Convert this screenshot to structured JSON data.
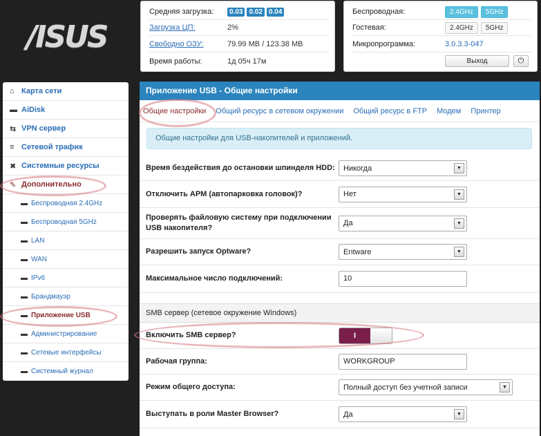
{
  "logo": "/ISUS",
  "status_left": {
    "load_label": "Средняя загрузка:",
    "load_values": [
      "0.03",
      "0.02",
      "0.04"
    ],
    "cpu_label": "Загрузка ЦП:",
    "cpu_value": "2%",
    "ram_label": "Свободно ОЗУ:",
    "ram_value": "79.99 MB / 123.38 MB",
    "uptime_label": "Время работы:",
    "uptime_value": "1д 05ч 17м"
  },
  "status_right": {
    "wireless_label": "Беспроводная:",
    "wireless_2g": "2.4GHz",
    "wireless_5g": "5GHz",
    "guest_label": "Гостевая:",
    "guest_2g": "2.4GHz",
    "guest_5g": "5GHz",
    "firmware_label": "Микропрограмма:",
    "firmware_value": "3.0.3.3-047",
    "logout_label": "Выход",
    "power_icon": "⏻"
  },
  "sidebar": {
    "items": [
      {
        "label": "Карта сети",
        "icon": "⌂"
      },
      {
        "label": "AiDisk",
        "icon": "▬"
      },
      {
        "label": "VPN сервер",
        "icon": "⇆"
      },
      {
        "label": "Сетевой трафик",
        "icon": "≡"
      },
      {
        "label": "Системные ресурсы",
        "icon": "✖"
      },
      {
        "label": "Дополнительно",
        "icon": "✎"
      }
    ],
    "subitems": [
      "Беспроводная 2.4GHz",
      "Беспроводная 5GHz",
      "LAN",
      "WAN",
      "IPv6",
      "Брандмауэр",
      "Приложение USB",
      "Администрирование",
      "Сетевые интерфейсы",
      "Системный журнал"
    ]
  },
  "main": {
    "title": "Приложение USB - Общие настройки",
    "tabs": [
      "Общие настройки",
      "Общий ресурс в сетевом окружении",
      "Общий ресурс в FTP",
      "Модем",
      "Принтер"
    ],
    "info": "Общие настройки для USB-накопителей и приложений.",
    "fields": {
      "spindown_label": "Время бездействия до остановки шпинделя HDD:",
      "spindown_value": "Никогда",
      "apm_label": "Отключить APM (автопарковка головок)?",
      "apm_value": "Нет",
      "fscheck_label": "Проверять файловую систему при подключении USB накопителя?",
      "fscheck_value": "Да",
      "optware_label": "Разрешить запуск Optware?",
      "optware_value": "Entware",
      "maxconn_label": "Максимальное число подключений:",
      "maxconn_value": "10"
    },
    "smb_section": "SMB сервер (сетевое окружение Windows)",
    "smb": {
      "enable_label": "Включить SMB сервер?",
      "enable_on_text": "I",
      "workgroup_label": "Рабочая группа:",
      "workgroup_value": "WORKGROUP",
      "access_label": "Режим общего доступа:",
      "access_value": "Полный доступ без учетной записи",
      "master_label": "Выступать в роли Master Browser?",
      "master_value": "Да"
    }
  }
}
